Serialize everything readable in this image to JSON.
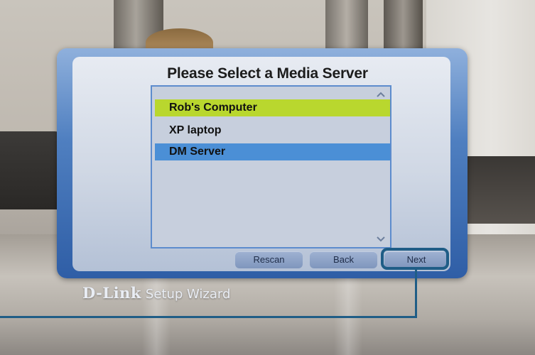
{
  "dialog": {
    "title": "Please Select a Media Server",
    "servers": [
      {
        "label": "Rob's Computer",
        "state": "highlighted"
      },
      {
        "label": "XP laptop",
        "state": "normal"
      },
      {
        "label": "DM Server",
        "state": "selected"
      }
    ],
    "buttons": {
      "rescan_label": "Rescan",
      "back_label": "Back",
      "next_label": "Next"
    }
  },
  "footer": {
    "brand": "D-Link",
    "subtitle": "Setup Wizard"
  },
  "colors": {
    "highlight_green": "#b9d72e",
    "selection_blue": "#4b8fd6",
    "callout": "#1f5d86"
  }
}
